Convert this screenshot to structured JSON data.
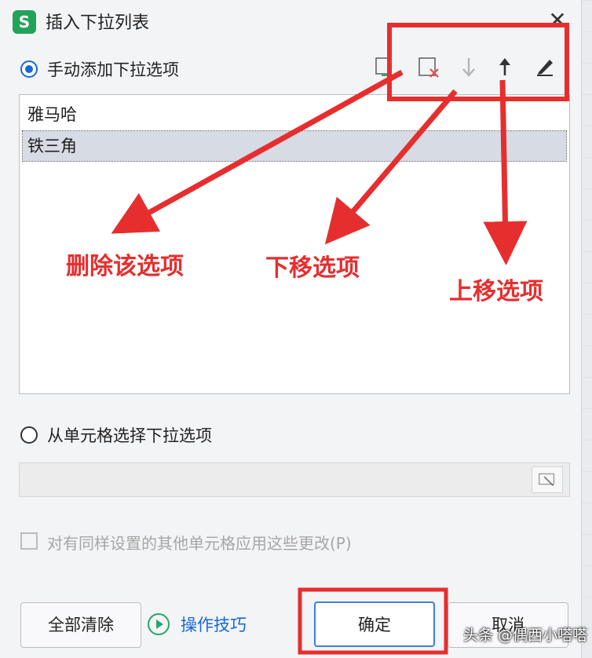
{
  "dialog": {
    "title": "插入下拉列表",
    "app_icon": "S",
    "close_icon": "✕"
  },
  "manual": {
    "label": "手动添加下拉选项",
    "selected": true,
    "toolbar_icons": [
      "add-item-icon",
      "delete-item-icon",
      "move-down-icon",
      "move-up-icon",
      "edit-icon"
    ]
  },
  "list": {
    "items": [
      "雅马哈",
      "铁三角"
    ],
    "selected_index": 1
  },
  "from_cells": {
    "label": "从单元格选择下拉选项",
    "selected": false
  },
  "apply_all": {
    "label": "对有同样设置的其他单元格应用这些更改(P)",
    "checked": false
  },
  "footer": {
    "clear_all": "全部清除",
    "tips": "操作技巧",
    "ok": "确定",
    "cancel": "取消"
  },
  "annotations": {
    "delete": "删除该选项",
    "move_down": "下移选项",
    "move_up": "上移选项",
    "color": "#e62e2e"
  },
  "watermark": "头条 @偶西小嗒嗒"
}
